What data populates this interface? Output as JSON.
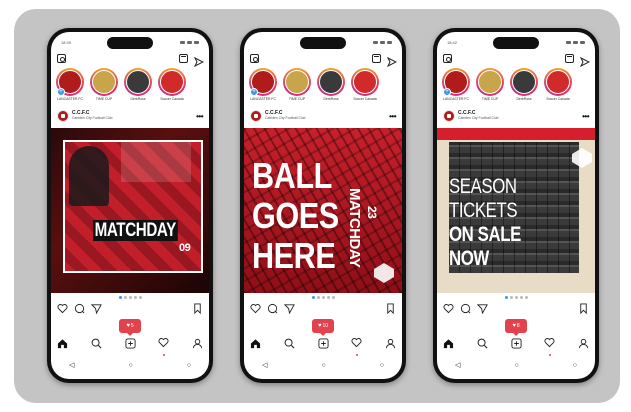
{
  "phones": [
    {
      "status_time": "18:39",
      "stories": [
        {
          "label": "LANCASTER FC",
          "color": "#b01c1c",
          "has_plus": true
        },
        {
          "label": "TIME CUP",
          "color": "#c8a44a",
          "has_plus": false
        },
        {
          "label": "DerbRoss",
          "color": "#3a3a3a",
          "has_plus": false
        },
        {
          "label": "Soccer Canada",
          "color": "#d02a2a",
          "has_plus": false
        }
      ],
      "post_user": "C.C.F.C",
      "post_sub": "Camden City Football Club",
      "post_text_1": "MATCHDAY",
      "post_text_2": "09",
      "notification_count": "5"
    },
    {
      "status_time": "",
      "stories": [
        {
          "label": "LANCASTER FC",
          "color": "#b01c1c",
          "has_plus": true
        },
        {
          "label": "TIME CUP",
          "color": "#c8a44a",
          "has_plus": false
        },
        {
          "label": "DerbRoss",
          "color": "#3a3a3a",
          "has_plus": false
        },
        {
          "label": "Soccer Canada",
          "color": "#d02a2a",
          "has_plus": false
        }
      ],
      "post_user": "C.C.F.C",
      "post_sub": "Camden City Football Club",
      "post_text_1": "BALL",
      "post_text_2": "GOES",
      "post_text_3": "HERE",
      "post_text_4": "MATCHDAY",
      "post_text_5": "23",
      "notification_count": "10"
    },
    {
      "status_time": "18:42",
      "stories": [
        {
          "label": "LANCASTER FC",
          "color": "#b01c1c",
          "has_plus": true
        },
        {
          "label": "TIME CUP",
          "color": "#c8a44a",
          "has_plus": false
        },
        {
          "label": "DerbRoss",
          "color": "#3a3a3a",
          "has_plus": false
        },
        {
          "label": "Soccer Canada",
          "color": "#d02a2a",
          "has_plus": false
        }
      ],
      "post_user": "C.C.F.C",
      "post_sub": "Camden City Football Club",
      "post_text_1": "SEASON",
      "post_text_2": "TICKETS",
      "post_text_3": "ON SALE",
      "post_text_4": "NOW",
      "notification_count": "8"
    }
  ],
  "colors": {
    "brand_red": "#d61f2c",
    "notification": "#e1424b",
    "active_dot": "#3897f0"
  }
}
